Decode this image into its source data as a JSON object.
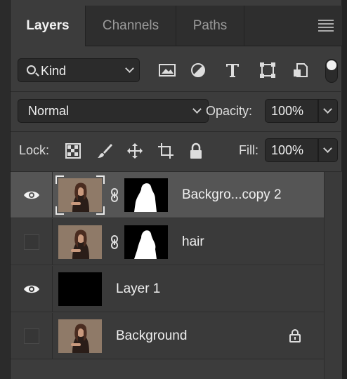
{
  "tabs": [
    {
      "label": "Layers",
      "active": true
    },
    {
      "label": "Channels",
      "active": false
    },
    {
      "label": "Paths",
      "active": false
    }
  ],
  "filter": {
    "kind_label": "Kind",
    "icons": [
      "image-filter-icon",
      "adjustment-filter-icon",
      "type-filter-icon",
      "shape-filter-icon",
      "smart-object-filter-icon"
    ]
  },
  "blend": {
    "mode": "Normal",
    "opacity_label": "Opacity:",
    "opacity_value": "100%"
  },
  "lock": {
    "label": "Lock:",
    "fill_label": "Fill:",
    "fill_value": "100%"
  },
  "layers": [
    {
      "name": "Backgro...copy 2",
      "visible": true,
      "selected": true,
      "has_mask": true,
      "thumb": "photo"
    },
    {
      "name": "hair",
      "visible": false,
      "selected": false,
      "has_mask": true,
      "thumb": "photo"
    },
    {
      "name": "Layer 1",
      "visible": true,
      "selected": false,
      "has_mask": false,
      "thumb": "black"
    },
    {
      "name": "Background",
      "visible": false,
      "selected": false,
      "has_mask": false,
      "thumb": "photo",
      "locked": true
    }
  ]
}
